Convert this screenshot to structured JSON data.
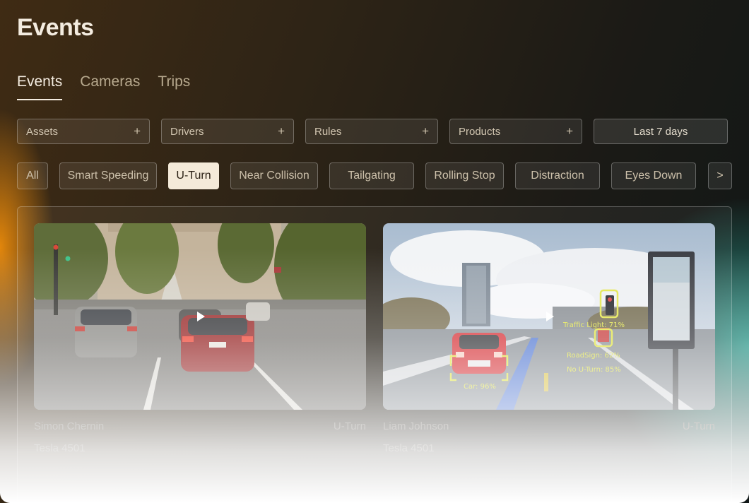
{
  "page": {
    "title": "Events"
  },
  "tabs": [
    {
      "label": "Events",
      "active": true
    },
    {
      "label": "Cameras",
      "active": false
    },
    {
      "label": "Trips",
      "active": false
    }
  ],
  "filters": [
    {
      "label": "Assets",
      "icon": "plus-icon"
    },
    {
      "label": "Drivers",
      "icon": "plus-icon"
    },
    {
      "label": "Rules",
      "icon": "plus-icon"
    },
    {
      "label": "Products",
      "icon": "plus-icon"
    }
  ],
  "date_range": "Last 7 days",
  "chips": [
    {
      "label": "All",
      "selected": false
    },
    {
      "label": "Smart Speeding",
      "selected": false
    },
    {
      "label": "U-Turn",
      "selected": true
    },
    {
      "label": "Near Collision",
      "selected": false
    },
    {
      "label": "Tailgating",
      "selected": false
    },
    {
      "label": "Rolling Stop",
      "selected": false
    },
    {
      "label": "Distraction",
      "selected": false
    },
    {
      "label": "Eyes Down",
      "selected": false
    },
    {
      "label": ">",
      "selected": false
    }
  ],
  "events": [
    {
      "driver": "Simon Chernin",
      "type": "U-Turn",
      "vehicle": "Tesla 4501",
      "icon": "play-icon"
    },
    {
      "driver": "Liam Johnson",
      "type": "U-Turn",
      "vehicle": "Tesla 4501",
      "icon": "play-icon"
    }
  ],
  "overlays": {
    "traffic_light": "Traffic Light: 71%",
    "road_sign": "RoadSign: 62%",
    "no_uturn": "No U-Turn: 85%",
    "car": "Car: 96%"
  },
  "colors": {
    "accent_selected": "#f4ead9",
    "detection_box": "#e3e64a"
  }
}
